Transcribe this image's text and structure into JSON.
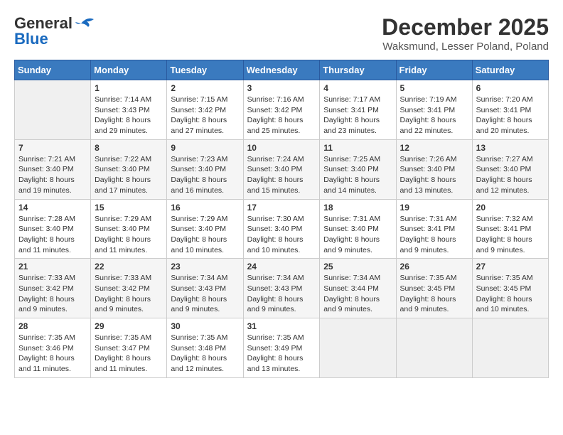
{
  "header": {
    "logo_general": "General",
    "logo_blue": "Blue",
    "month_title": "December 2025",
    "location": "Waksmund, Lesser Poland, Poland"
  },
  "days_of_week": [
    "Sunday",
    "Monday",
    "Tuesday",
    "Wednesday",
    "Thursday",
    "Friday",
    "Saturday"
  ],
  "weeks": [
    [
      {
        "day": "",
        "info": ""
      },
      {
        "day": "1",
        "info": "Sunrise: 7:14 AM\nSunset: 3:43 PM\nDaylight: 8 hours\nand 29 minutes."
      },
      {
        "day": "2",
        "info": "Sunrise: 7:15 AM\nSunset: 3:42 PM\nDaylight: 8 hours\nand 27 minutes."
      },
      {
        "day": "3",
        "info": "Sunrise: 7:16 AM\nSunset: 3:42 PM\nDaylight: 8 hours\nand 25 minutes."
      },
      {
        "day": "4",
        "info": "Sunrise: 7:17 AM\nSunset: 3:41 PM\nDaylight: 8 hours\nand 23 minutes."
      },
      {
        "day": "5",
        "info": "Sunrise: 7:19 AM\nSunset: 3:41 PM\nDaylight: 8 hours\nand 22 minutes."
      },
      {
        "day": "6",
        "info": "Sunrise: 7:20 AM\nSunset: 3:41 PM\nDaylight: 8 hours\nand 20 minutes."
      }
    ],
    [
      {
        "day": "7",
        "info": "Sunrise: 7:21 AM\nSunset: 3:40 PM\nDaylight: 8 hours\nand 19 minutes."
      },
      {
        "day": "8",
        "info": "Sunrise: 7:22 AM\nSunset: 3:40 PM\nDaylight: 8 hours\nand 17 minutes."
      },
      {
        "day": "9",
        "info": "Sunrise: 7:23 AM\nSunset: 3:40 PM\nDaylight: 8 hours\nand 16 minutes."
      },
      {
        "day": "10",
        "info": "Sunrise: 7:24 AM\nSunset: 3:40 PM\nDaylight: 8 hours\nand 15 minutes."
      },
      {
        "day": "11",
        "info": "Sunrise: 7:25 AM\nSunset: 3:40 PM\nDaylight: 8 hours\nand 14 minutes."
      },
      {
        "day": "12",
        "info": "Sunrise: 7:26 AM\nSunset: 3:40 PM\nDaylight: 8 hours\nand 13 minutes."
      },
      {
        "day": "13",
        "info": "Sunrise: 7:27 AM\nSunset: 3:40 PM\nDaylight: 8 hours\nand 12 minutes."
      }
    ],
    [
      {
        "day": "14",
        "info": "Sunrise: 7:28 AM\nSunset: 3:40 PM\nDaylight: 8 hours\nand 11 minutes."
      },
      {
        "day": "15",
        "info": "Sunrise: 7:29 AM\nSunset: 3:40 PM\nDaylight: 8 hours\nand 11 minutes."
      },
      {
        "day": "16",
        "info": "Sunrise: 7:29 AM\nSunset: 3:40 PM\nDaylight: 8 hours\nand 10 minutes."
      },
      {
        "day": "17",
        "info": "Sunrise: 7:30 AM\nSunset: 3:40 PM\nDaylight: 8 hours\nand 10 minutes."
      },
      {
        "day": "18",
        "info": "Sunrise: 7:31 AM\nSunset: 3:40 PM\nDaylight: 8 hours\nand 9 minutes."
      },
      {
        "day": "19",
        "info": "Sunrise: 7:31 AM\nSunset: 3:41 PM\nDaylight: 8 hours\nand 9 minutes."
      },
      {
        "day": "20",
        "info": "Sunrise: 7:32 AM\nSunset: 3:41 PM\nDaylight: 8 hours\nand 9 minutes."
      }
    ],
    [
      {
        "day": "21",
        "info": "Sunrise: 7:33 AM\nSunset: 3:42 PM\nDaylight: 8 hours\nand 9 minutes."
      },
      {
        "day": "22",
        "info": "Sunrise: 7:33 AM\nSunset: 3:42 PM\nDaylight: 8 hours\nand 9 minutes."
      },
      {
        "day": "23",
        "info": "Sunrise: 7:34 AM\nSunset: 3:43 PM\nDaylight: 8 hours\nand 9 minutes."
      },
      {
        "day": "24",
        "info": "Sunrise: 7:34 AM\nSunset: 3:43 PM\nDaylight: 8 hours\nand 9 minutes."
      },
      {
        "day": "25",
        "info": "Sunrise: 7:34 AM\nSunset: 3:44 PM\nDaylight: 8 hours\nand 9 minutes."
      },
      {
        "day": "26",
        "info": "Sunrise: 7:35 AM\nSunset: 3:45 PM\nDaylight: 8 hours\nand 9 minutes."
      },
      {
        "day": "27",
        "info": "Sunrise: 7:35 AM\nSunset: 3:45 PM\nDaylight: 8 hours\nand 10 minutes."
      }
    ],
    [
      {
        "day": "28",
        "info": "Sunrise: 7:35 AM\nSunset: 3:46 PM\nDaylight: 8 hours\nand 11 minutes."
      },
      {
        "day": "29",
        "info": "Sunrise: 7:35 AM\nSunset: 3:47 PM\nDaylight: 8 hours\nand 11 minutes."
      },
      {
        "day": "30",
        "info": "Sunrise: 7:35 AM\nSunset: 3:48 PM\nDaylight: 8 hours\nand 12 minutes."
      },
      {
        "day": "31",
        "info": "Sunrise: 7:35 AM\nSunset: 3:49 PM\nDaylight: 8 hours\nand 13 minutes."
      },
      {
        "day": "",
        "info": ""
      },
      {
        "day": "",
        "info": ""
      },
      {
        "day": "",
        "info": ""
      }
    ]
  ]
}
